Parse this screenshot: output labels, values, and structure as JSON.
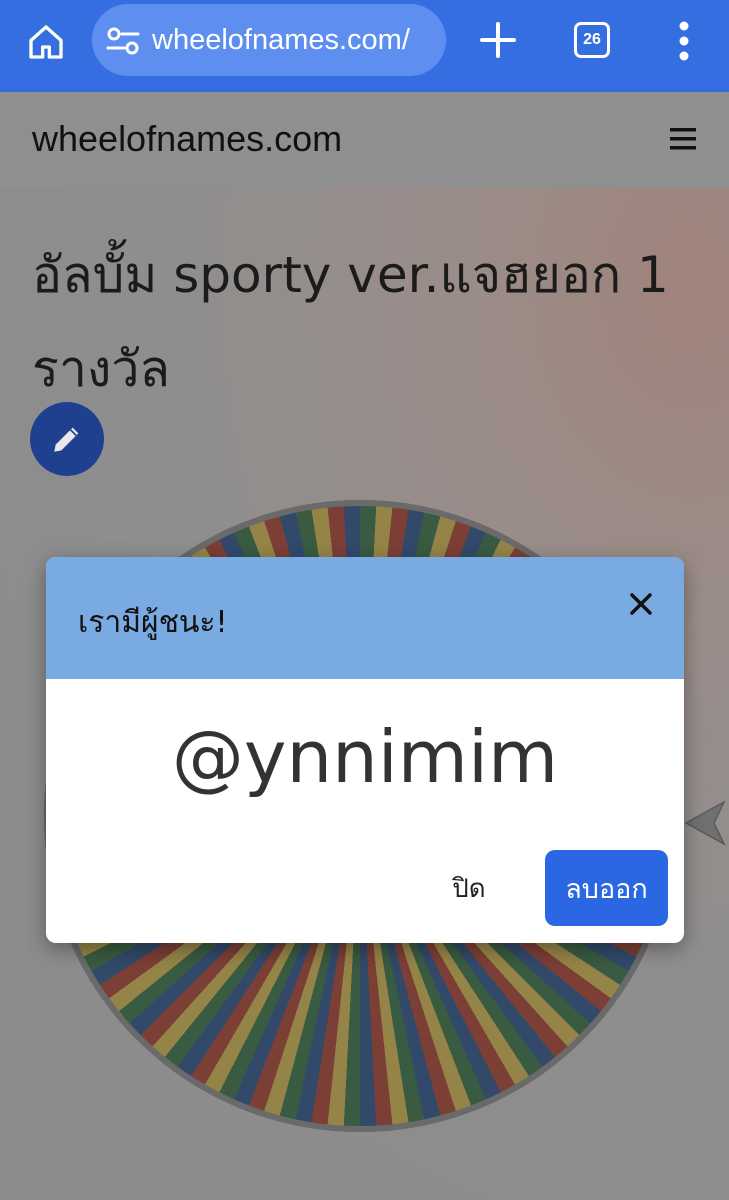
{
  "browser": {
    "url": "wheelofnames.com/",
    "tab_count": "26"
  },
  "site": {
    "title": "wheelofnames.com"
  },
  "wheel": {
    "title": "อัลบั้ม sporty ver.แจฮยอก 1 รางวัล"
  },
  "modal": {
    "title": "เรามีผู้ชนะ!",
    "winner": "@ynnimim",
    "close_label": "ปิด",
    "remove_label": "ลบออก"
  },
  "icons": [
    "home-icon",
    "tune-icon",
    "plus-icon",
    "tabs-icon",
    "more-vert-icon",
    "menu-icon",
    "pencil-icon",
    "close-icon",
    "pointer-icon"
  ],
  "colors": {
    "browser_bar": "#346ee0",
    "modal_header": "#7aaae2",
    "primary_button": "#2b66e3",
    "edit_button": "#1f3f8f"
  }
}
